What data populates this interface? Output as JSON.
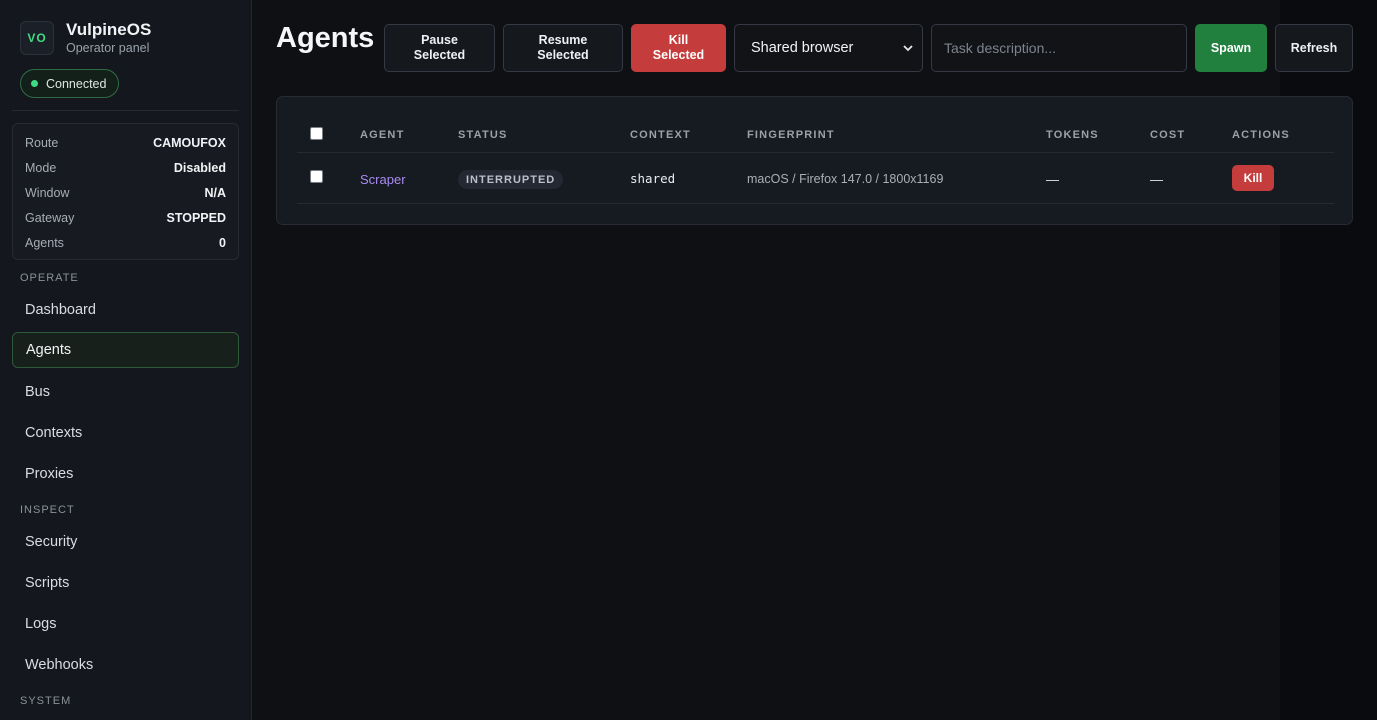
{
  "brand": {
    "logo": "VO",
    "title": "VulpineOS",
    "subtitle": "Operator panel"
  },
  "connection": {
    "label": "Connected",
    "color": "#3ddc84"
  },
  "status": [
    {
      "key": "Route",
      "value": "CAMOUFOX"
    },
    {
      "key": "Mode",
      "value": "Disabled"
    },
    {
      "key": "Window",
      "value": "N/A"
    },
    {
      "key": "Gateway",
      "value": "STOPPED"
    },
    {
      "key": "Agents",
      "value": "0"
    }
  ],
  "sections": {
    "operate": "OPERATE",
    "inspect": "INSPECT",
    "system": "SYSTEM"
  },
  "nav": {
    "operate": [
      "Dashboard",
      "Agents",
      "Bus",
      "Contexts",
      "Proxies"
    ],
    "inspect": [
      "Security",
      "Scripts",
      "Logs",
      "Webhooks"
    ],
    "active": "Agents"
  },
  "page": {
    "title": "Agents"
  },
  "toolbar": {
    "pause_line1": "Pause",
    "pause_line2": "Selected",
    "resume_line1": "Resume",
    "resume_line2": "Selected",
    "kill_line1": "Kill",
    "kill_line2": "Selected",
    "context_select": "Shared browser",
    "task_placeholder": "Task description...",
    "spawn": "Spawn",
    "refresh": "Refresh"
  },
  "table": {
    "headers": [
      "AGENT",
      "STATUS",
      "CONTEXT",
      "FINGERPRINT",
      "TOKENS",
      "COST",
      "ACTIONS"
    ],
    "rows": [
      {
        "agent": "Scraper",
        "status": "INTERRUPTED",
        "context": "shared",
        "fingerprint": "macOS / Firefox 147.0 / 1800x1169",
        "tokens": "—",
        "cost": "—",
        "action": "Kill"
      }
    ]
  },
  "colors": {
    "accent_green": "#22803f",
    "danger_red": "#c53c3c",
    "link_purple": "#a98bf0"
  }
}
